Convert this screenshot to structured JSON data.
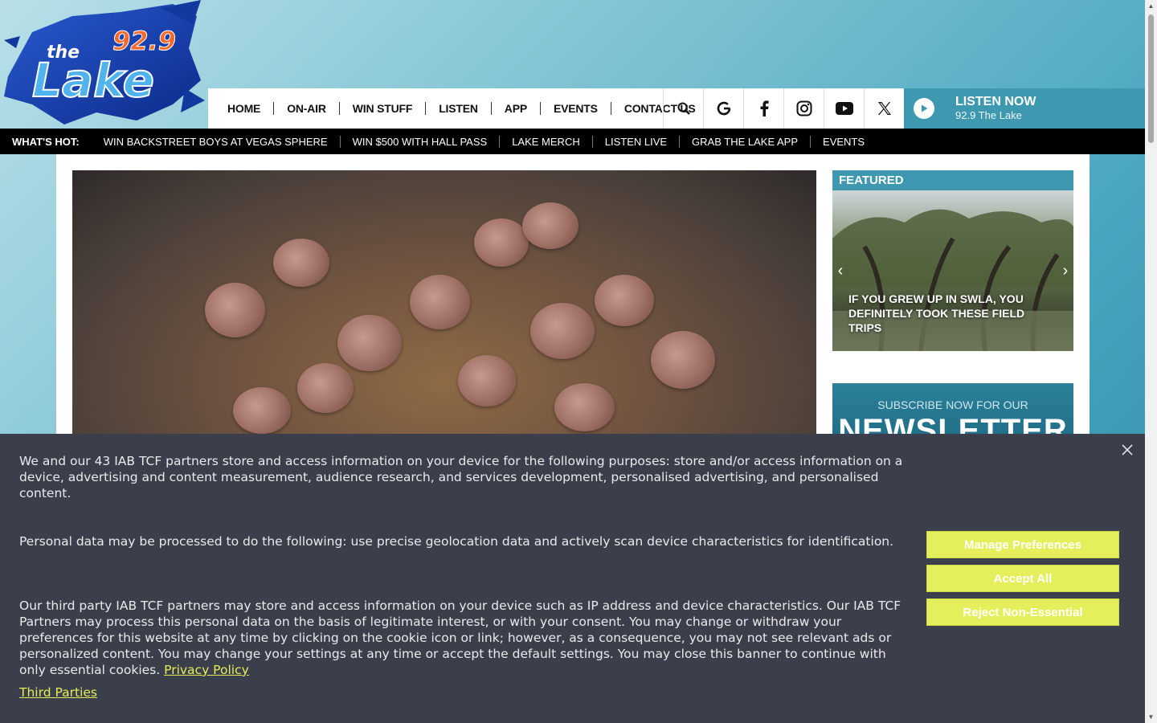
{
  "logo": {
    "text_the": "the",
    "text_lake": "Lake",
    "text_freq": "92.9"
  },
  "nav": {
    "items": [
      "HOME",
      "ON-AIR",
      "WIN STUFF",
      "LISTEN",
      "APP",
      "EVENTS",
      "CONTACT US"
    ],
    "icons": [
      "search-icon",
      "google-icon",
      "facebook-icon",
      "instagram-icon",
      "youtube-icon",
      "x-icon"
    ]
  },
  "listen": {
    "label": "LISTEN NOW",
    "station": "92.9 The Lake"
  },
  "hot": {
    "label": "WHAT'S HOT:",
    "items": [
      "WIN BACKSTREET BOYS AT VEGAS SPHERE",
      "WIN $500 WITH HALL PASS",
      "LAKE MERCH",
      "LISTEN LIVE",
      "GRAB THE LAKE APP",
      "EVENTS"
    ]
  },
  "featured": {
    "label": "FEATURED",
    "caption": "IF YOU GREW UP IN SWLA, YOU DEFINITELY TOOK THESE FIELD TRIPS"
  },
  "newsletter": {
    "sub": "SUBSCRIBE NOW FOR OUR",
    "title": "NEWSLETTER"
  },
  "consent": {
    "p1": "We and our 43 IAB TCF partners store and access information on your device for the following purposes: store and/or access information on a device, advertising and content measurement, audience research, and services development, personalised advertising, and personalised content.",
    "p2": "Personal data may be processed to do the following: use precise geolocation data and actively scan device characteristics for identification.",
    "p3": "Our third party IAB TCF partners may store and access information on your device such as IP address and device characteristics. Our IAB TCF Partners may process this personal data on the basis of legitimate interest, or with your consent. You may change or withdraw your preferences for this website at any time by clicking on the cookie icon or link; however, as a consequence, you may not see relevant ads or personalized content. You may change your settings at any time or accept the default settings. You may close this banner to continue with only essential cookies.",
    "privacy_link": "Privacy Policy",
    "third_parties": "Third Parties",
    "btn_manage": "Manage Preferences",
    "btn_accept": "Accept All",
    "btn_reject": "Reject Non-Essential"
  },
  "colors": {
    "accent": "#3e98af",
    "consent_bg": "#3a3f4b",
    "button": "#e5ef5c"
  }
}
